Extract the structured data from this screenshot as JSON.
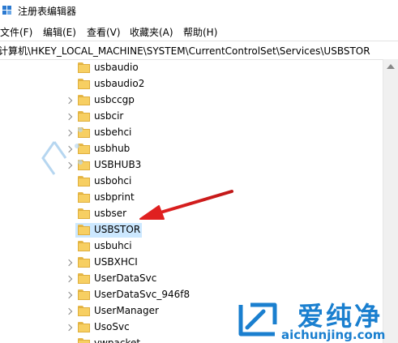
{
  "window": {
    "title": "注册表编辑器"
  },
  "menu": [
    "文件(F)",
    "编辑(E)",
    "查看(V)",
    "收藏夹(A)",
    "帮助(H)"
  ],
  "address": "计算机\\HKEY_LOCAL_MACHINE\\SYSTEM\\CurrentControlSet\\Services\\USBSTOR",
  "tree": {
    "items": [
      {
        "label": "usbaudio",
        "expandable": false
      },
      {
        "label": "usbaudio2",
        "expandable": false
      },
      {
        "label": "usbccgp",
        "expandable": true
      },
      {
        "label": "usbcir",
        "expandable": true
      },
      {
        "label": "usbehci",
        "expandable": true
      },
      {
        "label": "usbhub",
        "expandable": true
      },
      {
        "label": "USBHUB3",
        "expandable": true
      },
      {
        "label": "usbohci",
        "expandable": false
      },
      {
        "label": "usbprint",
        "expandable": false
      },
      {
        "label": "usbser",
        "expandable": false
      },
      {
        "label": "USBSTOR",
        "expandable": false,
        "selected": true
      },
      {
        "label": "usbuhci",
        "expandable": false
      },
      {
        "label": "USBXHCI",
        "expandable": true
      },
      {
        "label": "UserDataSvc",
        "expandable": true
      },
      {
        "label": "UserDataSvc_946f8",
        "expandable": true
      },
      {
        "label": "UserManager",
        "expandable": true
      },
      {
        "label": "UsoSvc",
        "expandable": true
      },
      {
        "label": "vwpacket",
        "expandable": false
      }
    ]
  },
  "watermark": {
    "brand": "爱纯净",
    "url": "aichunjing.com"
  },
  "colors": {
    "selection": "#cce8ff",
    "folder": "#f7cf62",
    "arrow": "#e02020",
    "watermark": "#1a7fcf"
  }
}
